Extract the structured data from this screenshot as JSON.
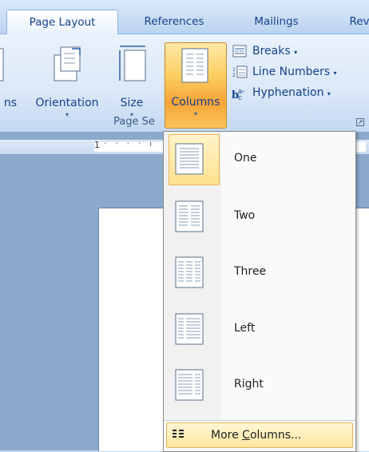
{
  "tabs": {
    "page_layout": "Page Layout",
    "references": "References",
    "mailings": "Mailings",
    "review_partial": "Rev"
  },
  "ribbon": {
    "margins_partial": "ns",
    "orientation": "Orientation",
    "size": "Size",
    "columns": "Columns",
    "breaks": "Breaks",
    "line_numbers": "Line Numbers",
    "hyphenation": "Hyphenation",
    "group_label": "Page Se",
    "dropdown_arrow": "▾"
  },
  "ruler": {
    "one": "1",
    "ticks": "· · · · ı"
  },
  "columns_menu": {
    "items": [
      {
        "label": "One"
      },
      {
        "label": "Two"
      },
      {
        "label": "Three"
      },
      {
        "label": "Left"
      },
      {
        "label": "Right"
      }
    ],
    "more_prefix": "More ",
    "more_accel": "C",
    "more_suffix": "olumns..."
  },
  "colors": {
    "ribbon_bg": "#dde9f8",
    "tab_text": "#15428b",
    "highlight_orange": "#f7a437",
    "menu_hover": "#fde28e"
  }
}
